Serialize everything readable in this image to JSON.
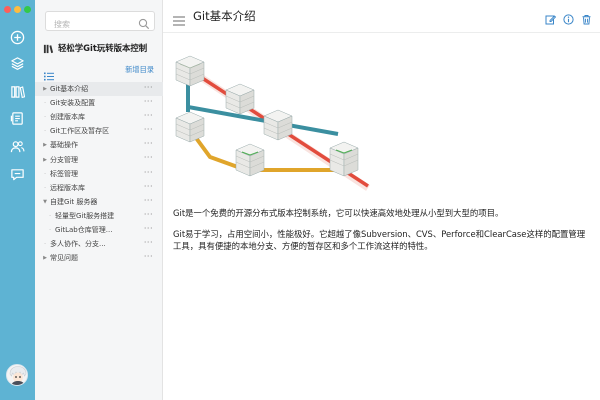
{
  "window": {
    "traffic_colors": [
      "#fc605b",
      "#fdbc40",
      "#34c84a"
    ]
  },
  "rail": {
    "icons": [
      "plus-circle-icon",
      "layers-icon",
      "books-icon",
      "document-icon",
      "users-icon",
      "chat-icon"
    ],
    "accent": "#5eb3d3"
  },
  "search": {
    "placeholder": "搜索"
  },
  "book": {
    "title": "轻松学Git玩转版本控制"
  },
  "toc": {
    "add_label": "新增目录",
    "items": [
      {
        "label": "Git基本介绍",
        "level": 0,
        "arrow": "collapsed",
        "active": true
      },
      {
        "label": "Git安装及配置",
        "level": 0,
        "arrow": "none",
        "active": false
      },
      {
        "label": "创建版本库",
        "level": 0,
        "arrow": "none",
        "active": false
      },
      {
        "label": "Git工作区及暂存区",
        "level": 0,
        "arrow": "none",
        "active": false
      },
      {
        "label": "基础操作",
        "level": 0,
        "arrow": "collapsed",
        "active": false
      },
      {
        "label": "分支管理",
        "level": 0,
        "arrow": "collapsed",
        "active": false
      },
      {
        "label": "标签管理",
        "level": 0,
        "arrow": "none",
        "active": false
      },
      {
        "label": "远程版本库",
        "level": 0,
        "arrow": "none",
        "active": false
      },
      {
        "label": "自建Git 服务器",
        "level": 0,
        "arrow": "expanded",
        "active": false
      },
      {
        "label": "轻量型Git服务搭建",
        "level": 1,
        "arrow": "none",
        "active": false
      },
      {
        "label": "GitLab仓库管理...",
        "level": 1,
        "arrow": "none",
        "active": false
      },
      {
        "label": "多人协作、分支...",
        "level": 0,
        "arrow": "none",
        "active": false
      },
      {
        "label": "常见问题",
        "level": 0,
        "arrow": "collapsed",
        "active": false
      }
    ],
    "more_label": "···"
  },
  "doc": {
    "title": "Git基本介绍",
    "paragraphs": [
      "Git是一个免费的开源分布式版本控制系统，它可以快速高效地处理从小型到大型的项目。",
      "Git易于学习，占用空间小，性能极好。它超越了像Subversion、CVS、Perforce和ClearCase这样的配置管理工具，具有便捷的本地分支、方便的暂存区和多个工作流这样的特性。"
    ],
    "actions": [
      "edit-icon",
      "info-icon",
      "trash-icon"
    ],
    "action_color": "#3a86c8"
  }
}
